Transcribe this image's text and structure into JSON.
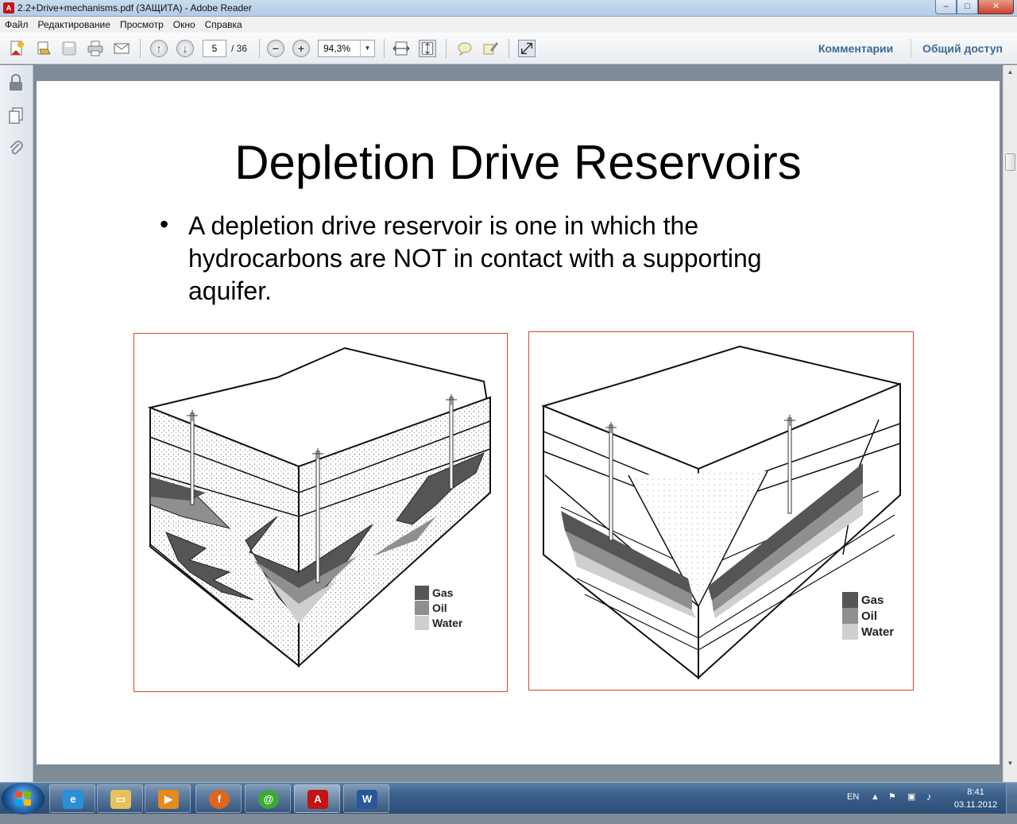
{
  "window": {
    "title": "2.2+Drive+mechanisms.pdf (ЗАЩИТА) - Adobe Reader",
    "min_label": "–",
    "max_label": "□",
    "close_label": "✕"
  },
  "menu": [
    "Файл",
    "Редактирование",
    "Просмотр",
    "Окно",
    "Справка"
  ],
  "toolbar": {
    "page_current": "5",
    "page_total": "/ 36",
    "zoom": "94,3%",
    "comments": "Комментарии",
    "share": "Общий доступ"
  },
  "slide": {
    "title": "Depletion Drive Reservoirs",
    "bullet_marker": "•",
    "bullet_text": "A depletion drive reservoir is one in which the hydrocarbons are NOT in contact with a supporting aquifer.",
    "figure1_legend": [
      "Gas",
      "Oil",
      "Water"
    ],
    "figure2_legend": [
      "Gas",
      "Oil",
      "Water"
    ]
  },
  "colors": {
    "gas": "#555555",
    "oil": "#8f8f8f",
    "water": "#cfcfcf",
    "figure_border": "#d0492e",
    "link": "#3e6a98"
  },
  "taskbar": {
    "apps": [
      "internet-explorer",
      "file-explorer",
      "media-player",
      "firefox",
      "mail-agent",
      "adobe-reader",
      "word"
    ],
    "lang": "EN",
    "time": "8:41",
    "date": "03.11.2012"
  }
}
